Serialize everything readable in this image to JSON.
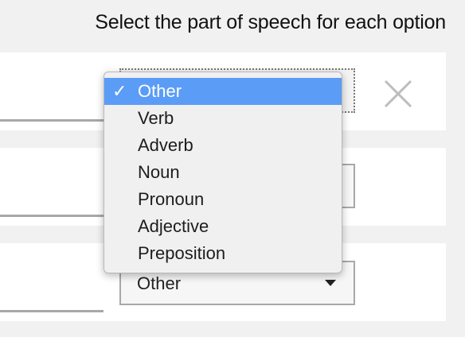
{
  "heading": "Select the part of speech for each option",
  "rows": [
    {
      "selected": "Other",
      "open": true
    },
    {
      "selected": ""
    },
    {
      "selected": "Other"
    }
  ],
  "dropdown": {
    "options": [
      "Other",
      "Verb",
      "Adverb",
      "Noun",
      "Pronoun",
      "Adjective",
      "Preposition"
    ],
    "selected_index": 0,
    "check_glyph": "✓"
  },
  "icons": {
    "close": "close-icon",
    "check": "check-icon",
    "select_arrow": "chevron-down-icon"
  },
  "colors": {
    "highlight": "#5b9cf6",
    "border": "#a8a8a8",
    "background": "#f1f1f1"
  }
}
